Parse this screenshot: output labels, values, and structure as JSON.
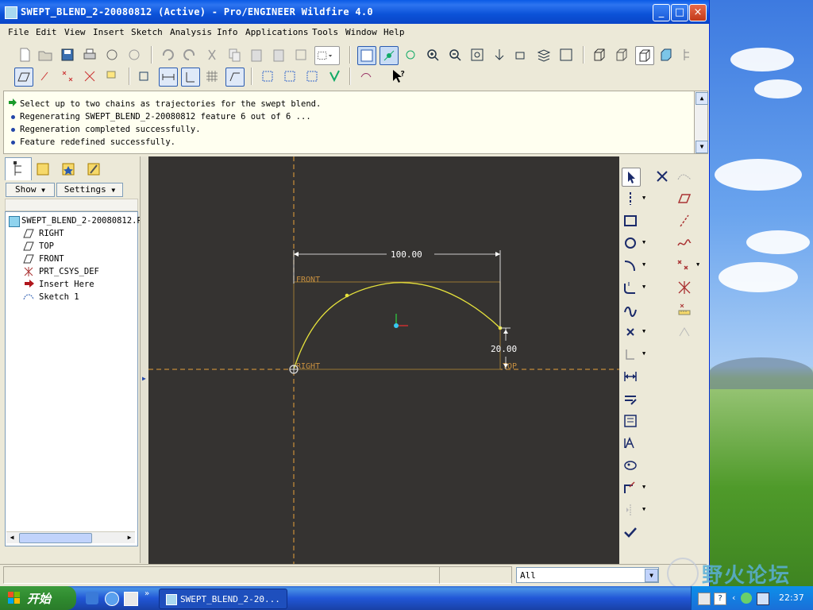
{
  "window": {
    "title": "SWEPT_BLEND_2-20080812 (Active) - Pro/ENGINEER Wildfire 4.0",
    "controls": {
      "minimize": "_",
      "maximize": "□",
      "close": "×"
    }
  },
  "menu": [
    "File",
    "Edit",
    "View",
    "Insert",
    "Sketch",
    "Analysis",
    "Info",
    "Applications",
    "Tools",
    "Window",
    "Help"
  ],
  "messages": [
    {
      "icon": "green-arrow-icon",
      "text": "Select up to two chains as trajectories for the swept blend."
    },
    {
      "icon": "bullet-icon",
      "text": "Regenerating SWEPT_BLEND_2-20080812 feature 6 out of 6 ..."
    },
    {
      "icon": "bullet-icon",
      "text": "Regeneration completed successfully."
    },
    {
      "icon": "bullet-icon",
      "text": "Feature redefined successfully."
    }
  ],
  "nav": {
    "show_label": "Show",
    "settings_label": "Settings",
    "tree": [
      {
        "icon": "part-icon",
        "label": "SWEPT_BLEND_2-20080812.P"
      },
      {
        "icon": "datum-plane-icon",
        "label": "RIGHT"
      },
      {
        "icon": "datum-plane-icon",
        "label": "TOP"
      },
      {
        "icon": "datum-plane-icon",
        "label": "FRONT"
      },
      {
        "icon": "csys-icon",
        "label": "PRT_CSYS_DEF"
      },
      {
        "icon": "insert-here-arrow-icon",
        "label": "Insert Here"
      },
      {
        "icon": "sketch-icon",
        "label": "Sketch 1"
      }
    ]
  },
  "sketch": {
    "dim_width": "100.00",
    "dim_height": "20.00",
    "label_front": "FRONT",
    "label_right": "RIGHT",
    "label_top": "TOP",
    "colors": {
      "background": "#353331",
      "curve": "#e6e23c",
      "dims": "#ffffff",
      "refs": "#e8a23a"
    }
  },
  "status": {
    "filter_value": "All"
  },
  "taskbar": {
    "start_label": "开始",
    "task_label": "SWEPT_BLEND_2-20...",
    "clock": "22:37"
  },
  "watermark": "野火论坛"
}
